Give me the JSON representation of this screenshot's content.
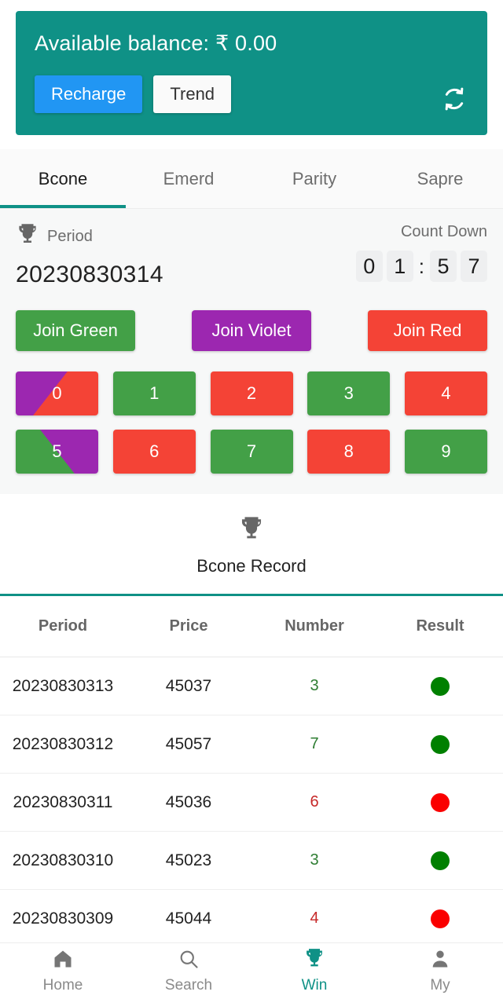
{
  "balance": {
    "label": "Available balance: ₹ 0.00",
    "recharge_label": "Recharge",
    "trend_label": "Trend",
    "refresh_icon": "refresh-sync-icon",
    "card_color": "#0f9186",
    "recharge_color": "#2196f3"
  },
  "tabs": [
    {
      "label": "Bcone",
      "active": true
    },
    {
      "label": "Emerd",
      "active": false
    },
    {
      "label": "Parity",
      "active": false
    },
    {
      "label": "Sapre",
      "active": false
    }
  ],
  "game": {
    "trophy_icon": "trophy-icon",
    "period_label": "Period",
    "period_value": "20230830314",
    "countdown_label": "Count Down",
    "countdown_digits": [
      "0",
      "1",
      "5",
      "7"
    ],
    "countdown_separator": ":",
    "joins": [
      {
        "label": "Join Green",
        "color": "#43a047"
      },
      {
        "label": "Join Violet",
        "color": "#9c27b0"
      },
      {
        "label": "Join Red",
        "color": "#f44336"
      }
    ],
    "numbers": [
      {
        "label": "0",
        "style": "violet-red"
      },
      {
        "label": "1",
        "style": "green"
      },
      {
        "label": "2",
        "style": "red"
      },
      {
        "label": "3",
        "style": "green"
      },
      {
        "label": "4",
        "style": "red"
      },
      {
        "label": "5",
        "style": "violet-green"
      },
      {
        "label": "6",
        "style": "red"
      },
      {
        "label": "7",
        "style": "green"
      },
      {
        "label": "8",
        "style": "red"
      },
      {
        "label": "9",
        "style": "green"
      }
    ]
  },
  "record": {
    "trophy_icon": "trophy-icon",
    "title": "Bcone Record",
    "columns": [
      "Period",
      "Price",
      "Number",
      "Result"
    ],
    "rows": [
      {
        "period": "20230830313",
        "price": "45037",
        "number": "3",
        "number_color": "green",
        "result": "green"
      },
      {
        "period": "20230830312",
        "price": "45057",
        "number": "7",
        "number_color": "green",
        "result": "green"
      },
      {
        "period": "20230830311",
        "price": "45036",
        "number": "6",
        "number_color": "red",
        "result": "red"
      },
      {
        "period": "20230830310",
        "price": "45023",
        "number": "3",
        "number_color": "green",
        "result": "green"
      },
      {
        "period": "20230830309",
        "price": "45044",
        "number": "4",
        "number_color": "red",
        "result": "red"
      }
    ]
  },
  "bottom_nav": [
    {
      "label": "Home",
      "icon": "home-icon",
      "active": false
    },
    {
      "label": "Search",
      "icon": "search-icon",
      "active": false
    },
    {
      "label": "Win",
      "icon": "trophy-icon",
      "active": true
    },
    {
      "label": "My",
      "icon": "person-icon",
      "active": false
    }
  ]
}
